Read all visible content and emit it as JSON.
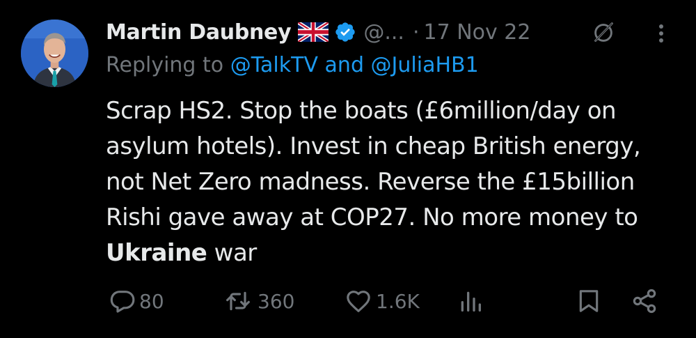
{
  "tweet": {
    "display_name": "Martin Daubney",
    "handle": "@...",
    "separator": "·",
    "timestamp": "17 Nov 22",
    "reply_prefix": "Replying to",
    "reply_user_1": "@TalkTV",
    "reply_conjunction": "and",
    "reply_user_2": "@JuliaHB1",
    "body_lines": [
      "Scrap HS2. Stop the boats (£6million/day on",
      "asylum hotels). Invest in cheap British energy,",
      "not Net Zero madness. Reverse the £15billion",
      "Rishi gave away at COP27. No more money to"
    ],
    "body_last_bold": "Ukraine",
    "body_last_rest": " war"
  },
  "actions": {
    "reply_count": "80",
    "retweet_count": "360",
    "like_count": "1.6K"
  },
  "icons": {
    "flag": "uk-flag-icon",
    "verified": "verified-badge-icon",
    "grok": "grok-icon",
    "more": "more-vertical-icon",
    "reply": "reply-icon",
    "retweet": "retweet-icon",
    "like": "heart-icon",
    "views": "views-icon",
    "bookmark": "bookmark-icon",
    "share": "share-icon"
  },
  "colors": {
    "background": "#000000",
    "text": "#e7e9ea",
    "secondary": "#71767b",
    "link": "#1d9bf0"
  }
}
